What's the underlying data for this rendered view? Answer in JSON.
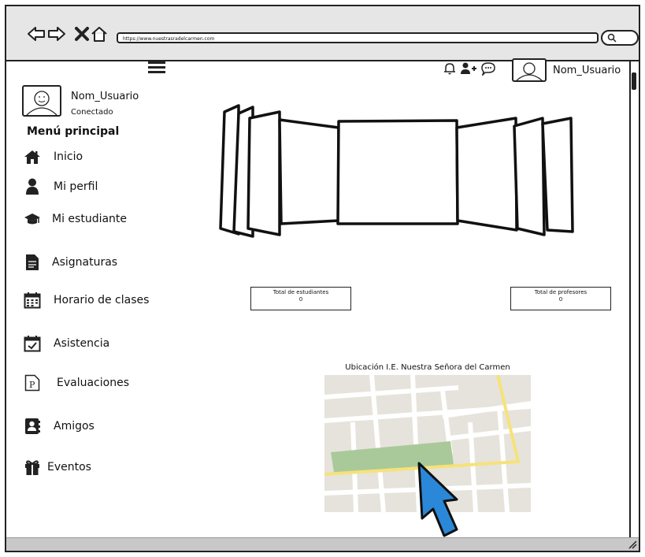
{
  "browser": {
    "url": "https://www.nuestrasradelcarmen.com"
  },
  "header": {
    "username": "Nom_Usuario"
  },
  "sidebar": {
    "username": "Nom_Usuario",
    "status": "Conectado",
    "menu_title": "Menú principal",
    "items": [
      {
        "label": "Inicio",
        "icon": "home-icon"
      },
      {
        "label": "Mi perfil",
        "icon": "user-icon"
      },
      {
        "label": "Mi estudiante",
        "icon": "graduation-cap-icon"
      },
      {
        "label": "Asignaturas",
        "icon": "document-icon"
      },
      {
        "label": "Horario de clases",
        "icon": "calendar-icon"
      },
      {
        "label": "Asistencia",
        "icon": "calendar-check-icon"
      },
      {
        "label": "Evaluaciones",
        "icon": "p-document-icon"
      },
      {
        "label": "Amigos",
        "icon": "contacts-icon"
      },
      {
        "label": "Eventos",
        "icon": "gift-icon"
      }
    ]
  },
  "stats": {
    "students": {
      "label": "Total de estudiantes",
      "value": "0"
    },
    "teachers": {
      "label": "Total de profesores",
      "value": "0"
    }
  },
  "map": {
    "title": "Ubicación I.E. Nuestra Señora del Carmen"
  },
  "colors": {
    "map_background": "#e6e3dc",
    "park": "#aac99a",
    "main_road": "#f6e279",
    "pointer": "#2b88d8"
  }
}
